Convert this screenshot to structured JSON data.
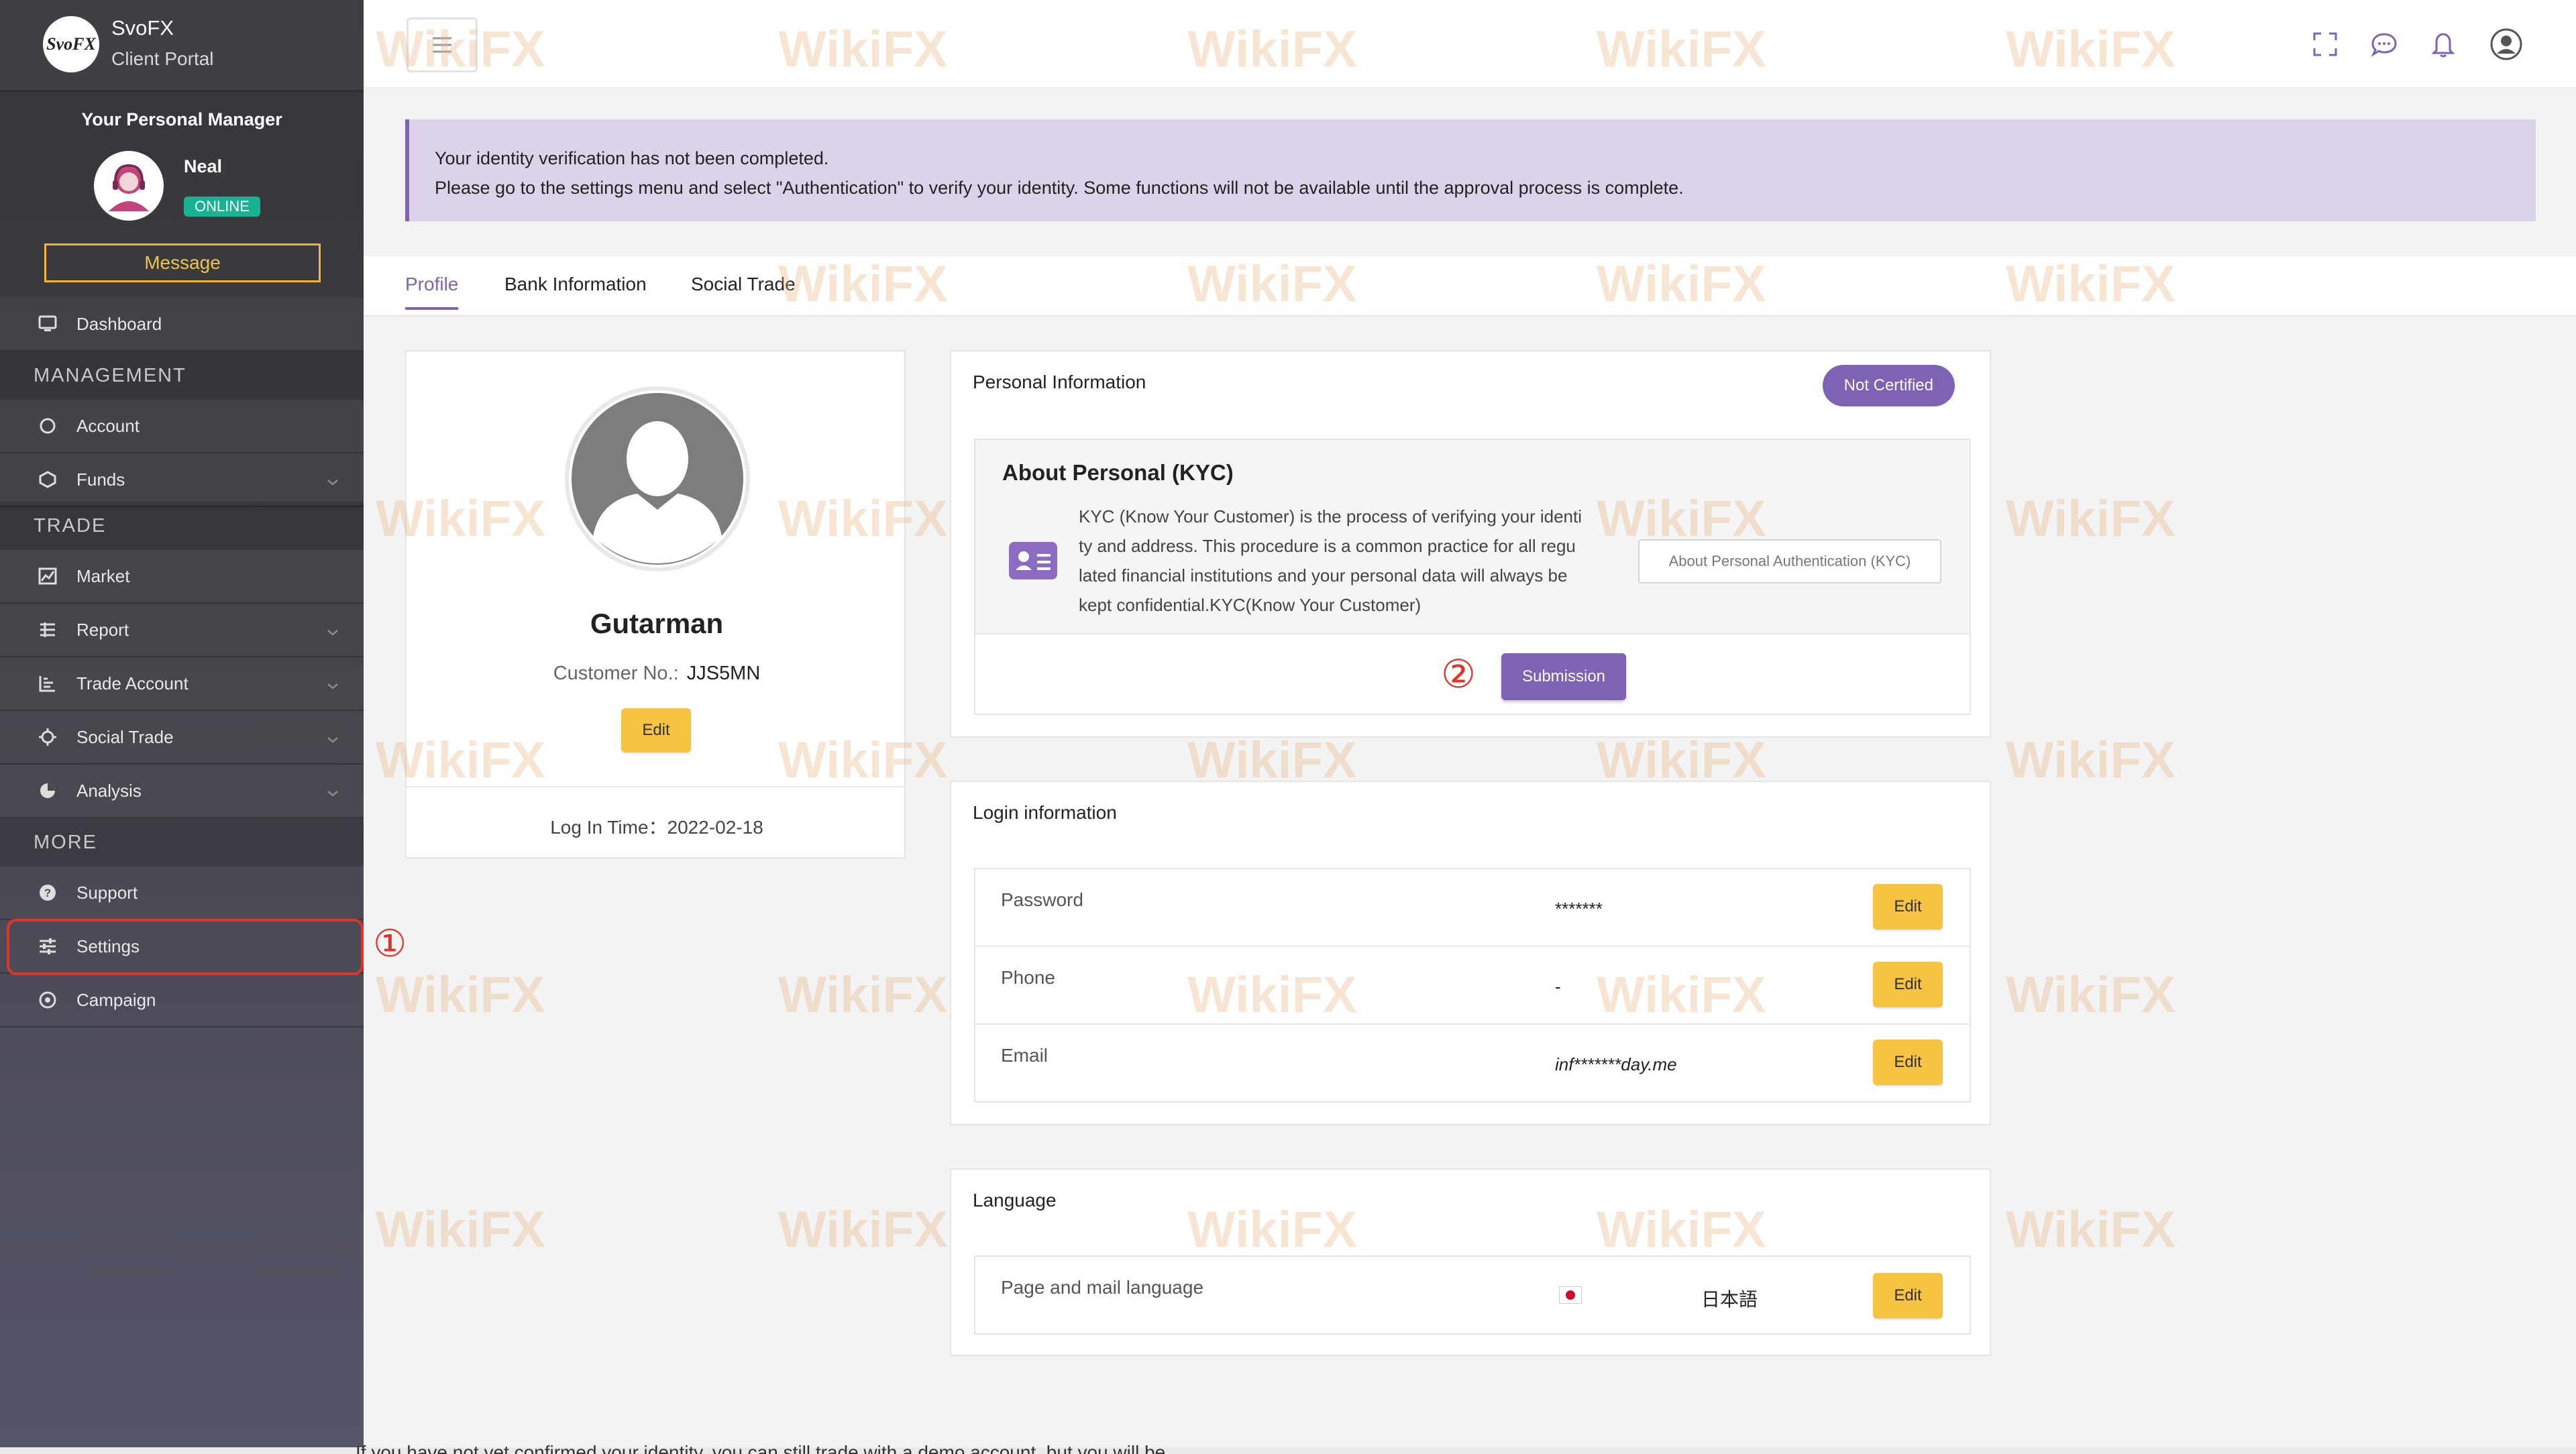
{
  "brand": {
    "logo_text": "SvoFX",
    "name": "SvoFX",
    "subtitle": "Client Portal"
  },
  "manager": {
    "title": "Your Personal Manager",
    "name": "Neal",
    "status": "ONLINE",
    "message_label": "Message"
  },
  "sidebar": {
    "dashboard": "Dashboard",
    "section_management": "MANAGEMENT",
    "account": "Account",
    "funds": "Funds",
    "section_trade": "TRADE",
    "market": "Market",
    "report": "Report",
    "trade_account": "Trade Account",
    "social_trade": "Social Trade",
    "analysis": "Analysis",
    "section_more": "MORE",
    "support": "Support",
    "settings": "Settings",
    "campaign": "Campaign"
  },
  "markers": {
    "step1": "①",
    "step2": "②"
  },
  "alert": {
    "line1": "Your identity verification has not been completed.",
    "line2": "Please go to the settings menu and select \"Authentication\" to verify your identity. Some functions will not be available until the approval process is complete."
  },
  "tabs": [
    "Profile",
    "Bank Information",
    "Social Trade"
  ],
  "profile": {
    "name": "Gutarman",
    "customer_no_label": "Customer No.:",
    "customer_no": "JJS5MN",
    "edit_label": "Edit",
    "login_time": "Log In Time：2022-02-18"
  },
  "personal": {
    "title": "Personal Information",
    "badge": "Not Certified",
    "kyc_title": "About Personal (KYC)",
    "kyc_lines": [
      "KYC (Know Your Customer) is the process of verifying your identi",
      "ty and address. This procedure is a common practice for all regu",
      "lated financial institutions and your personal data will always be",
      "kept confidential.KYC(Know Your Customer)"
    ],
    "kyc_about_button": "About Personal Authentication (KYC)",
    "submit_label": "Submission"
  },
  "login_info": {
    "title": "Login information",
    "rows": [
      {
        "label": "Password",
        "value": "*******",
        "edit": "Edit"
      },
      {
        "label": "Phone",
        "value": "-",
        "edit": "Edit"
      },
      {
        "label": "Email",
        "value": "inf*******day.me",
        "edit": "Edit"
      }
    ]
  },
  "language": {
    "title": "Language",
    "label": "Page and mail language",
    "value": "日本語",
    "edit": "Edit"
  },
  "bottom_text": "If you have not yet confirmed your identity, you can still trade with a demo account, but you will be",
  "watermark": "WikiFX",
  "colors": {
    "accent": "#7e62b3",
    "button_yellow": "#f6c343",
    "online": "#19b394",
    "marker_red": "#e0332a"
  }
}
